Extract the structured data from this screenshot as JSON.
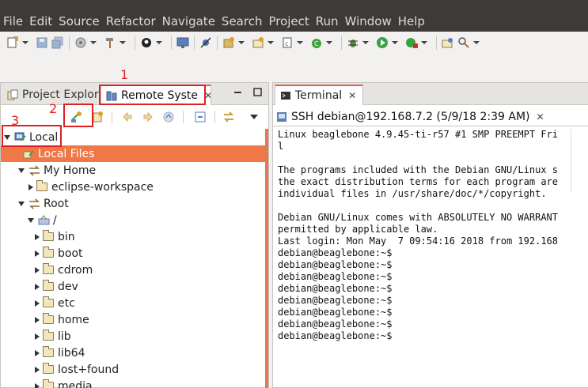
{
  "menubar": {
    "items": [
      "File",
      "Edit",
      "Source",
      "Refactor",
      "Navigate",
      "Search",
      "Project",
      "Run",
      "Window",
      "Help"
    ]
  },
  "left_view": {
    "tabs": [
      {
        "label": "Project Explor",
        "icon": "project-explorer-icon"
      },
      {
        "label": "Remote Syste",
        "icon": "remote-systems-icon",
        "active": true
      }
    ],
    "tree": [
      {
        "label": "Local",
        "depth": 0,
        "expanded": true,
        "icon": "local-connection-icon"
      },
      {
        "label": "Local Files",
        "depth": 1,
        "selected": true,
        "icon": "files-subsystem-icon"
      },
      {
        "label": "My Home",
        "depth": 1,
        "expanded": true,
        "icon": "filter-icon"
      },
      {
        "label": "eclipse-workspace",
        "depth": 2,
        "expanded": false,
        "icon": "folder-icon"
      },
      {
        "label": "Root",
        "depth": 1,
        "expanded": true,
        "icon": "filter-icon"
      },
      {
        "label": "/",
        "depth": 2,
        "expanded": true,
        "icon": "root-drive-icon"
      },
      {
        "label": "bin",
        "depth": 3,
        "expanded": false,
        "icon": "folder-icon"
      },
      {
        "label": "boot",
        "depth": 3,
        "expanded": false,
        "icon": "folder-icon"
      },
      {
        "label": "cdrom",
        "depth": 3,
        "expanded": false,
        "icon": "folder-icon"
      },
      {
        "label": "dev",
        "depth": 3,
        "expanded": false,
        "icon": "folder-icon"
      },
      {
        "label": "etc",
        "depth": 3,
        "expanded": false,
        "icon": "folder-icon"
      },
      {
        "label": "home",
        "depth": 3,
        "expanded": false,
        "icon": "folder-icon"
      },
      {
        "label": "lib",
        "depth": 3,
        "expanded": false,
        "icon": "folder-icon"
      },
      {
        "label": "lib64",
        "depth": 3,
        "expanded": false,
        "icon": "folder-icon"
      },
      {
        "label": "lost+found",
        "depth": 3,
        "expanded": false,
        "icon": "folder-icon"
      },
      {
        "label": "media",
        "depth": 3,
        "expanded": false,
        "icon": "folder-icon"
      }
    ]
  },
  "annotations": [
    "1",
    "2",
    "3"
  ],
  "terminal_view": {
    "tab_label": "Terminal",
    "session_label": "SSH debian@192.168.7.2 (5/9/18 2:39 AM)",
    "lines": [
      "Linux beaglebone 4.9.45-ti-r57 #1 SMP PREEMPT Fri",
      "l",
      "",
      "The programs included with the Debian GNU/Linux s",
      "the exact distribution terms for each program are",
      "individual files in /usr/share/doc/*/copyright.",
      "",
      "Debian GNU/Linux comes with ABSOLUTELY NO WARRANT",
      "permitted by applicable law.",
      "Last login: Mon May  7 09:54:16 2018 from 192.168",
      "debian@beaglebone:~$",
      "debian@beaglebone:~$",
      "debian@beaglebone:~$",
      "debian@beaglebone:~$",
      "debian@beaglebone:~$",
      "debian@beaglebone:~$",
      "debian@beaglebone:~$",
      "debian@beaglebone:~$"
    ]
  },
  "colors": {
    "menubar_bg": "#3c3b37",
    "selection": "#f07746",
    "annotation": "#e02020"
  }
}
